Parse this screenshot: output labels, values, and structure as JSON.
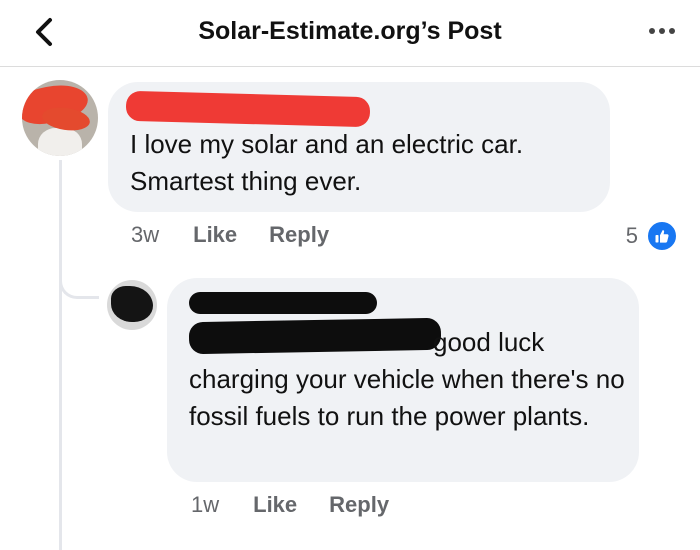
{
  "header": {
    "title": "Solar-Estimate.org’s Post",
    "back_icon": "chevron-left-icon",
    "more_icon": "ellipsis-icon"
  },
  "comments": [
    {
      "text": "I love my solar and an electric car. Smartest thing ever.",
      "time": "3w",
      "like_label": "Like",
      "reply_label": "Reply",
      "reaction_count": "5",
      "reaction_icon": "thumbs-up-icon",
      "reaction_color": "#1877f2"
    },
    {
      "text_first": "good luck",
      "text_rest": "charging your vehicle when there's no fossil fuels to run the power plants.",
      "time": "1w",
      "like_label": "Like",
      "reply_label": "Reply"
    }
  ],
  "colors": {
    "bubble": "#f0f2f5",
    "meta_text": "#65676b",
    "redaction_red": "#ef3a35",
    "redaction_black": "#0d0d0d"
  }
}
